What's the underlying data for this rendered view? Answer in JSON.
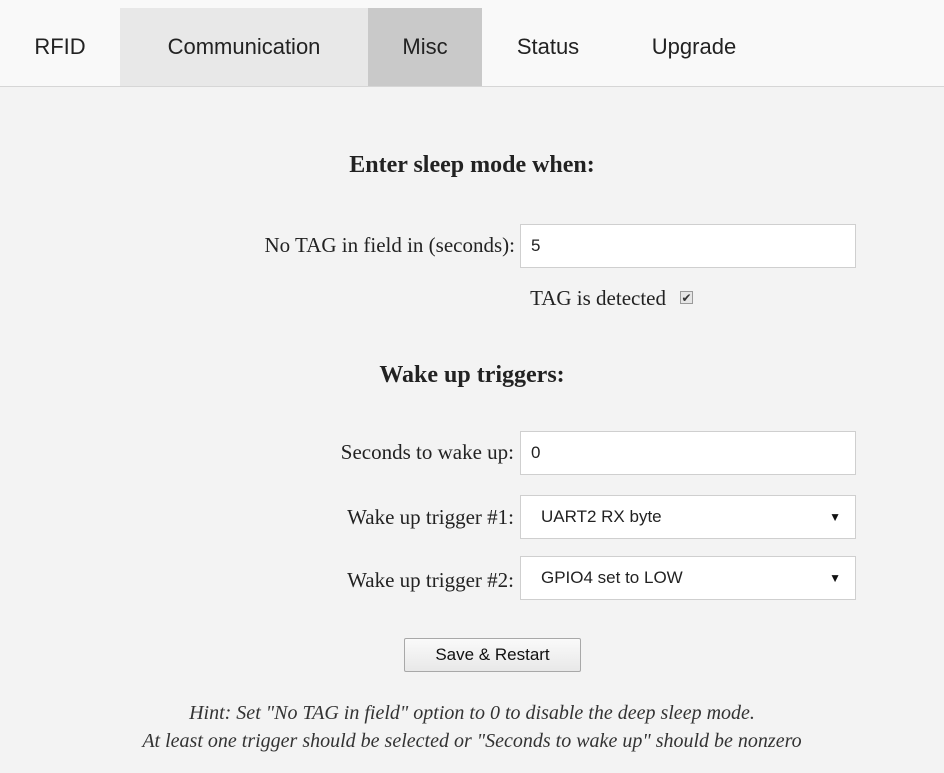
{
  "tabs": [
    {
      "label": "RFID"
    },
    {
      "label": "Communication"
    },
    {
      "label": "Misc"
    },
    {
      "label": "Status"
    },
    {
      "label": "Upgrade"
    }
  ],
  "active_tab": "Misc",
  "sleep": {
    "heading": "Enter sleep mode when:",
    "no_tag_label": "No TAG in field in (seconds):",
    "no_tag_value": "5",
    "tag_detected_label": "TAG is detected",
    "tag_detected_checked": true
  },
  "wake": {
    "heading": "Wake up triggers:",
    "seconds_label": "Seconds to wake up:",
    "seconds_value": "0",
    "trigger1_label": "Wake up trigger #1:",
    "trigger1_value": "UART2 RX byte",
    "trigger2_label": "Wake up trigger #2:",
    "trigger2_value": "GPIO4 set to LOW"
  },
  "save_label": "Save & Restart",
  "hint": {
    "line1": "Hint: Set \"No TAG in field\" option to 0 to disable the deep sleep mode.",
    "line2": "At least one trigger should be selected or \"Seconds to wake up\" should be nonzero"
  },
  "icons": {
    "dropdown": "chevron-down-icon",
    "checkbox": "checkmark-icon"
  }
}
